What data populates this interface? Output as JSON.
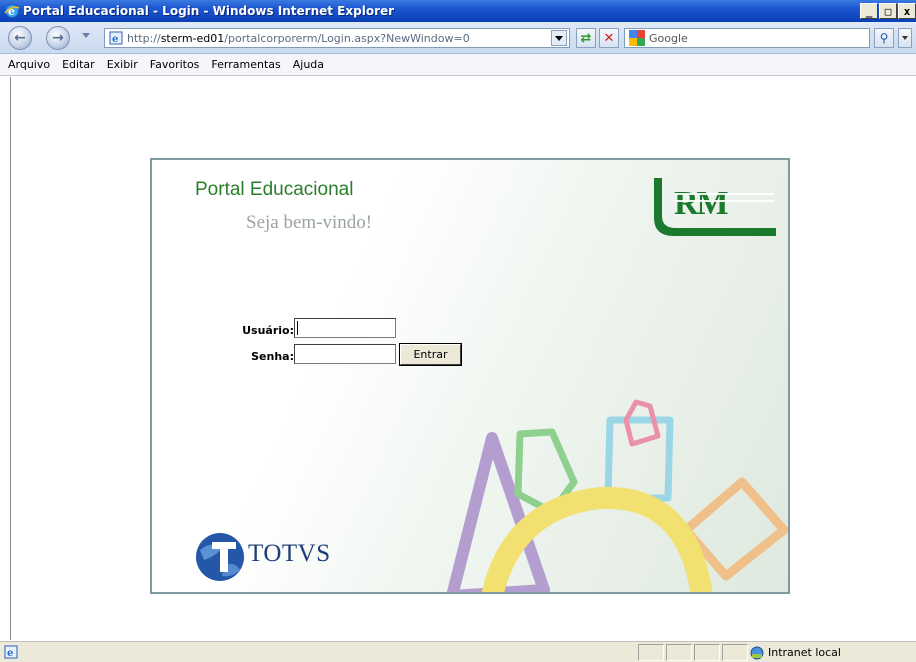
{
  "window": {
    "title": "Portal Educacional - Login - Windows Internet Explorer",
    "controls": {
      "minimize": "_",
      "maximize": "□",
      "close": "x"
    }
  },
  "navbar": {
    "url_prefix": "http://",
    "url_host": "sterm-ed01",
    "url_path": "/portalcorporerm/Login.aspx?NewWindow=0",
    "search_placeholder": "Google",
    "icons": [
      "back-icon",
      "forward-icon",
      "page-icon",
      "refresh-icon",
      "stop-icon",
      "google-icon",
      "search-icon"
    ]
  },
  "menu": {
    "items": [
      "Arquivo",
      "Editar",
      "Exibir",
      "Favoritos",
      "Ferramentas",
      "Ajuda"
    ]
  },
  "login": {
    "portal_title": "Portal Educacional",
    "welcome": "Seja bem-vindo!",
    "rm_logo_text": "RM",
    "username_label": "Usuário:",
    "username_value": "",
    "password_label": "Senha:",
    "password_value": "",
    "submit_label": "Entrar",
    "totvs_text": "TOTVS"
  },
  "status": {
    "zone": "Intranet local"
  },
  "colors": {
    "brand_green": "#2a7d2a",
    "rm_green": "#1c7a2e",
    "totvs_blue": "#1f3e78",
    "title_bar": "#1b55d0"
  }
}
